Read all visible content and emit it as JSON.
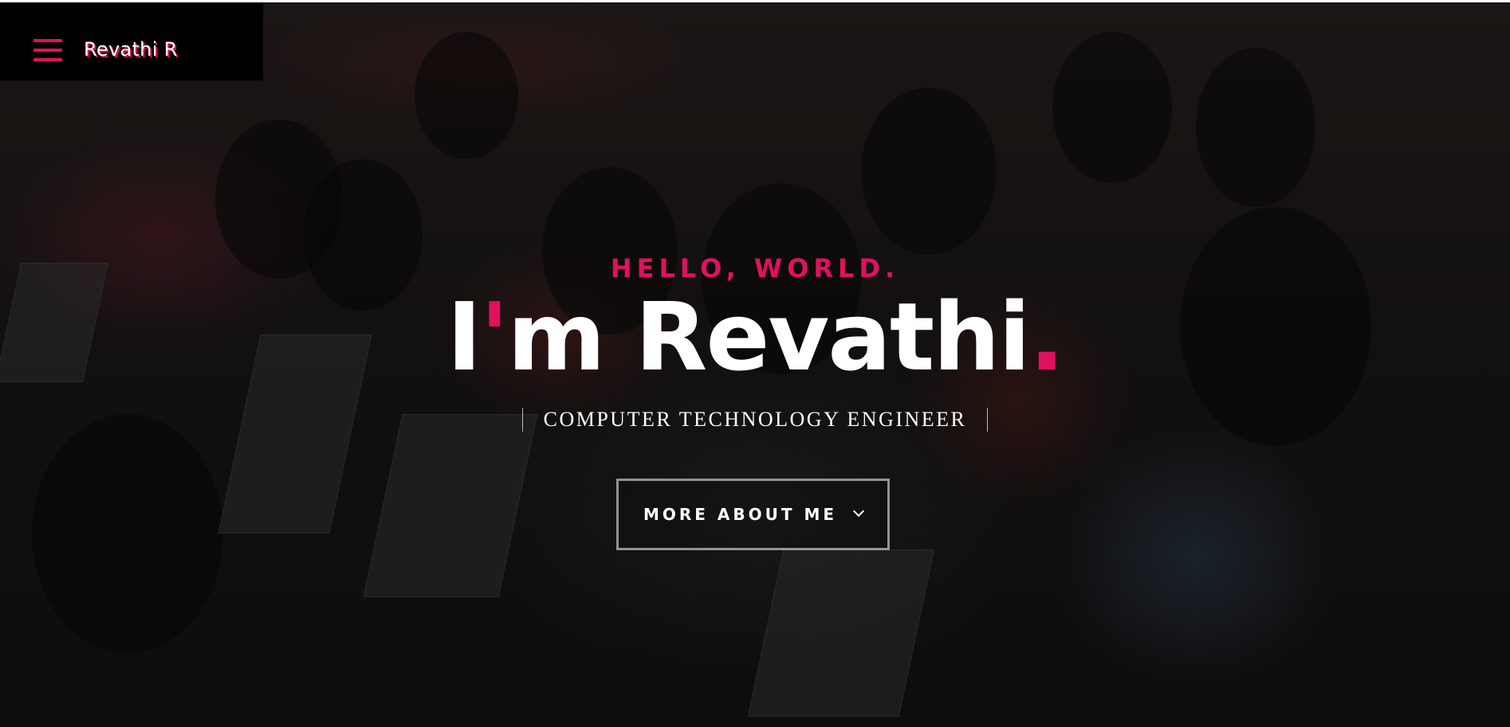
{
  "header": {
    "brand": "Revathi R",
    "menu_icon": "hamburger-menu-icon"
  },
  "hero": {
    "kicker": "HELLO, WORLD.",
    "headline_prefix": "I",
    "headline_apostrophe": "'",
    "headline_name": "m Revathi",
    "headline_dot": ".",
    "subtitle": "COMPUTER TECHNOLOGY ENGINEER",
    "cta_label": "MORE ABOUT ME",
    "cta_icon": "chevron-down-icon"
  },
  "colors": {
    "accent": "#e0115f",
    "text": "#ffffff",
    "header_bg": "#000000"
  }
}
